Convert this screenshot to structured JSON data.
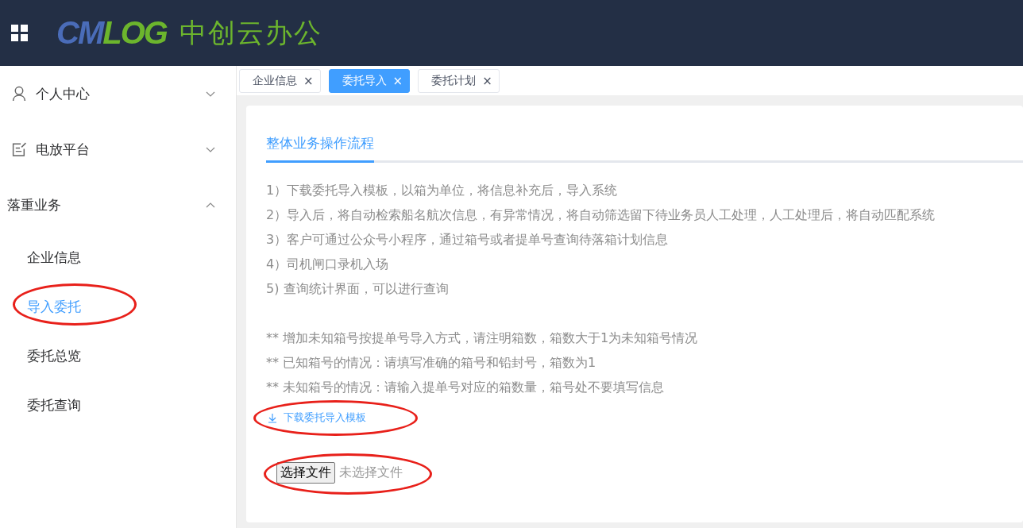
{
  "header": {
    "logo_left": "CM",
    "logo_right": "LOG",
    "app_name": "中创云办公"
  },
  "sidebar": {
    "groups": [
      {
        "label": "个人中心",
        "expanded": false
      },
      {
        "label": "电放平台",
        "expanded": false
      },
      {
        "label": "落重业务",
        "expanded": true,
        "children": [
          {
            "label": "企业信息",
            "selected": false
          },
          {
            "label": "导入委托",
            "selected": true
          },
          {
            "label": "委托总览",
            "selected": false
          },
          {
            "label": "委托查询",
            "selected": false
          }
        ]
      }
    ]
  },
  "tabs": [
    {
      "label": "企业信息",
      "selected": false,
      "close": "×"
    },
    {
      "label": "委托导入",
      "selected": true,
      "close": "×"
    },
    {
      "label": "委托计划",
      "selected": false,
      "close": "×"
    }
  ],
  "panel": {
    "tab": "整体业务操作流程",
    "steps": [
      "1）下载委托导入模板，以箱为单位，将信息补充后，导入系统",
      "2）导入后，将自动检索船名航次信息，有异常情况，将自动筛选留下待业务员人工处理，人工处理后，将自动匹配系统",
      "3）客户可通过公众号小程序，通过箱号或者提单号查询待落箱计划信息",
      "4）司机闸口录机入场",
      "5) 查询统计界面，可以进行查询"
    ],
    "notes": [
      "** 增加未知箱号按提单号导入方式，请注明箱数，箱数大于1为未知箱号情况",
      "** 已知箱号的情况：请填写准确的箱号和铅封号，箱数为1",
      "** 未知箱号的情况：请输入提单号对应的箱数量，箱号处不要填写信息"
    ],
    "download_link": "下载委托导入模板",
    "file_button": "选择文件",
    "file_status": "未选择文件"
  }
}
